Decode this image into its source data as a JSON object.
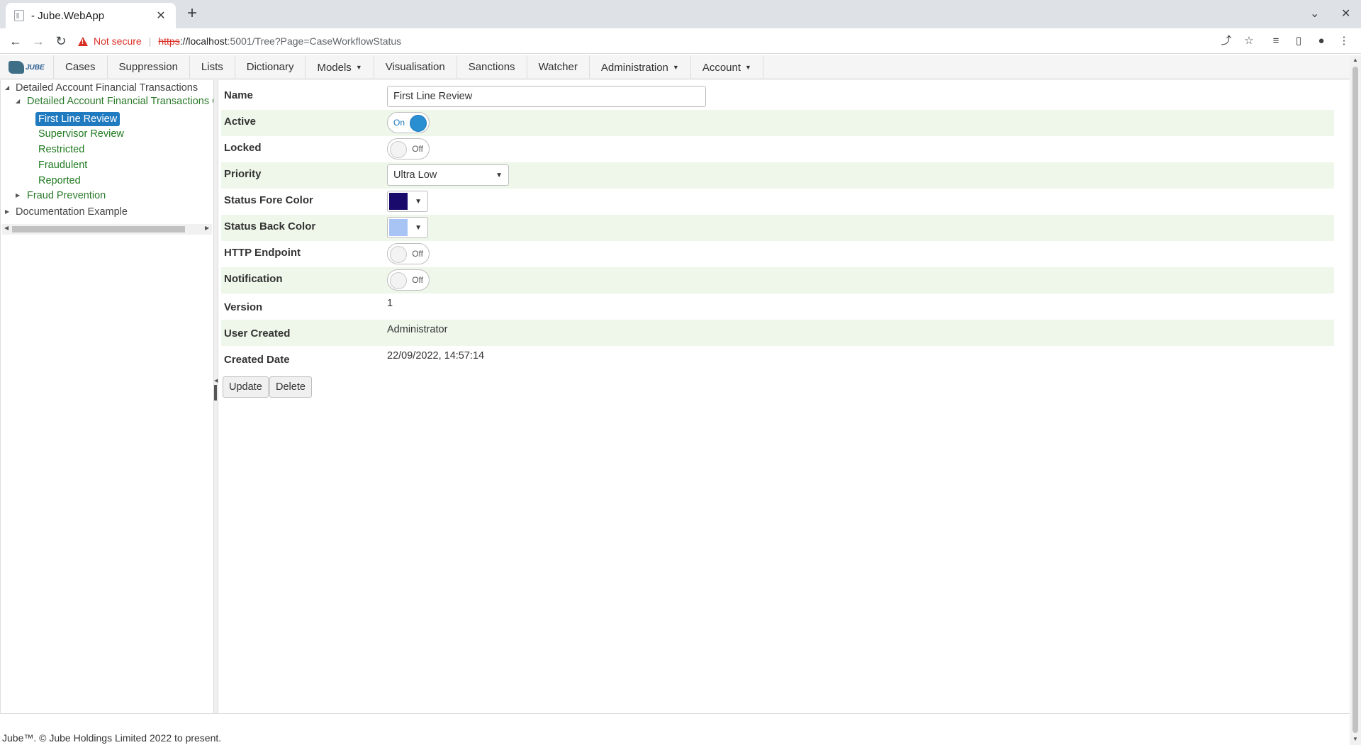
{
  "browser": {
    "tab_title": "- Jube.WebApp",
    "close_tab": "✕",
    "new_tab": "+",
    "not_secure": "Not secure",
    "url_scheme": "https",
    "url_host": "://localhost",
    "url_rest": ":5001/Tree?Page=CaseWorkflowStatus"
  },
  "app": {
    "logo_text": "JUBE",
    "nav": [
      {
        "label": "Cases"
      },
      {
        "label": "Suppression"
      },
      {
        "label": "Lists"
      },
      {
        "label": "Dictionary"
      },
      {
        "label": "Models",
        "dropdown": true
      },
      {
        "label": "Visualisation"
      },
      {
        "label": "Sanctions"
      },
      {
        "label": "Watcher"
      },
      {
        "label": "Administration",
        "dropdown": true
      },
      {
        "label": "Account",
        "dropdown": true
      }
    ]
  },
  "tree": {
    "root1": "Detailed Account Financial Transactions",
    "group1": "Detailed Account Financial Transactions Case Workflow",
    "leaves": [
      "First Line Review",
      "Supervisor Review",
      "Restricted",
      "Fraudulent",
      "Reported"
    ],
    "group2": "Fraud Prevention",
    "root2": "Documentation Example"
  },
  "form": {
    "labels": {
      "name": "Name",
      "active": "Active",
      "locked": "Locked",
      "priority": "Priority",
      "fore_color": "Status Fore Color",
      "back_color": "Status Back Color",
      "http_endpoint": "HTTP Endpoint",
      "notification": "Notification",
      "version": "Version",
      "user_created": "User Created",
      "created_date": "Created Date"
    },
    "values": {
      "name": "First Line Review",
      "active": "On",
      "locked": "Off",
      "priority": "Ultra Low",
      "fore_color": "#1a0a6b",
      "back_color": "#a8c4f5",
      "http_endpoint": "Off",
      "notification": "Off",
      "version": "1",
      "user_created": "Administrator",
      "created_date": "22/09/2022, 14:57:14"
    },
    "buttons": {
      "update": "Update",
      "delete": "Delete"
    }
  },
  "footer": "Jube™. © Jube Holdings Limited 2022 to present.",
  "colors": {
    "accent": "#1f7ac0",
    "row_alt": "#eef7ea",
    "tree_link": "#1f7a1f"
  }
}
